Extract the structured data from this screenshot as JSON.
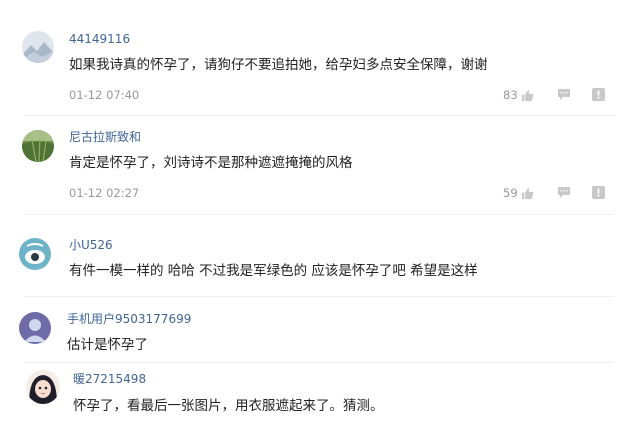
{
  "comments": [
    {
      "username": "44149116",
      "text": "如果我诗真的怀孕了，请狗仔不要追拍她，给孕妇多点安全保障，谢谢",
      "time": "01-12 07:40",
      "likes": "83",
      "avatar": "landscape-avatar"
    },
    {
      "username": "尼古拉斯致和",
      "text": "肯定是怀孕了，刘诗诗不是那种遮遮掩掩的风格",
      "time": "01-12 02:27",
      "likes": "59",
      "avatar": "green-field-avatar"
    },
    {
      "username": "小U526",
      "text": "有件一模一样的 哈哈 不过我是军绿色的 应该是怀孕了吧 希望是这样",
      "avatar": "cartoon-eye-avatar"
    },
    {
      "username": "手机用户9503177699",
      "text": "估计是怀孕了",
      "avatar": "default-user-avatar"
    },
    {
      "username": "暖27215498",
      "text": "怀孕了，看最后一张图片，用衣服遮起来了。猜测。",
      "avatar": "anime-girl-avatar"
    }
  ],
  "icons": {
    "like": "thumbs-up-icon",
    "reply": "comment-bubble-icon",
    "report": "report-flag-icon"
  },
  "colors": {
    "username": "#406599",
    "text": "#222222",
    "meta": "#999999",
    "icon": "#c8c8c8"
  }
}
